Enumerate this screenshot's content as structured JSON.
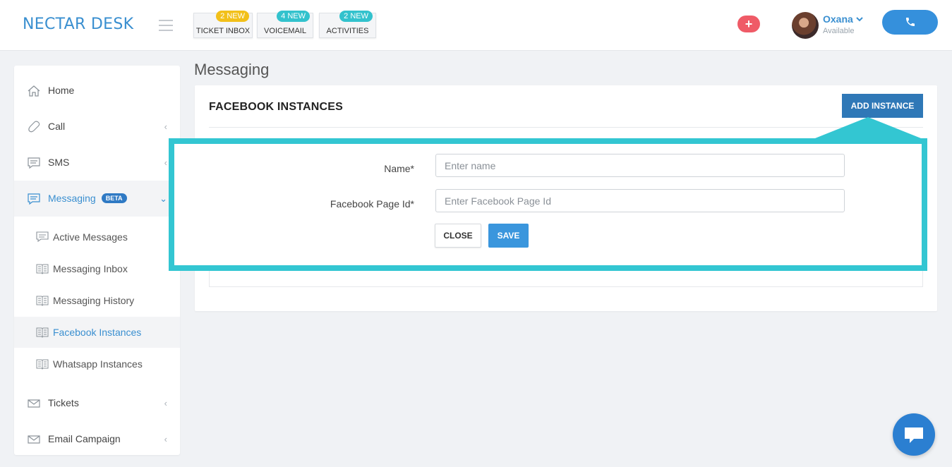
{
  "app": {
    "logo": "NECTAR DESK"
  },
  "header": {
    "tabs": [
      {
        "label": "TICKET INBOX",
        "badge": "2 NEW",
        "badge_color": "#f2c01a"
      },
      {
        "label": "VOICEMAIL",
        "badge": "4 NEW",
        "badge_color": "#33c2cd"
      },
      {
        "label": "ACTIVITIES",
        "badge": "2 NEW",
        "badge_color": "#33c2cd"
      }
    ],
    "plus_button": "+",
    "user": {
      "name": "Oxana",
      "status": "Available"
    },
    "call_icon": "phone-icon"
  },
  "sidebar": {
    "items": [
      {
        "label": "Home",
        "icon": "home-icon"
      },
      {
        "label": "Call",
        "icon": "phone-icon"
      },
      {
        "label": "SMS",
        "icon": "chat-icon"
      },
      {
        "label": "Messaging",
        "icon": "chat-icon",
        "badge": "BETA"
      },
      {
        "label": "Tickets",
        "icon": "envelope-icon"
      },
      {
        "label": "Email Campaign",
        "icon": "envelope-icon"
      }
    ],
    "subitems": [
      {
        "label": "Active Messages"
      },
      {
        "label": "Messaging Inbox"
      },
      {
        "label": "Messaging History"
      },
      {
        "label": "Facebook Instances"
      },
      {
        "label": "Whatsapp Instances"
      }
    ]
  },
  "main": {
    "page_title": "Messaging",
    "card_title": "FACEBOOK INSTANCES",
    "add_button": "ADD INSTANCE",
    "form": {
      "name_label": "Name*",
      "name_placeholder": "Enter name",
      "page_id_label": "Facebook Page Id*",
      "page_id_placeholder": "Enter Facebook Page Id",
      "close_label": "CLOSE",
      "save_label": "SAVE"
    }
  },
  "colors": {
    "accent": "#3a8fd0",
    "highlight": "#33c6d2",
    "primary_button": "#2f78b7"
  }
}
